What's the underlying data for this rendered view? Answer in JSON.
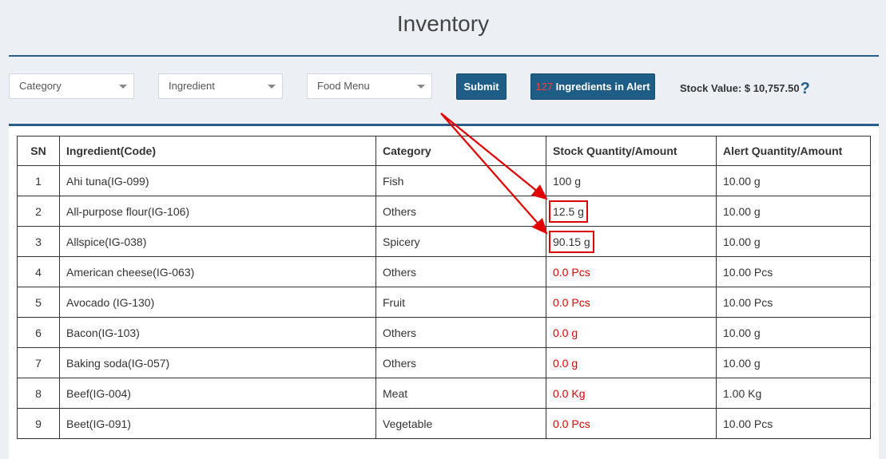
{
  "page": {
    "title": "Inventory"
  },
  "filters": {
    "category": "Category",
    "ingredient": "Ingredient",
    "food_menu": "Food Menu",
    "submit_label": "Submit"
  },
  "alert_button": {
    "count": "127",
    "label": " Ingredients in Alert"
  },
  "stock_value": {
    "label": "Stock Value: $ 10,757.50",
    "help_icon": "?"
  },
  "table": {
    "headers": [
      "SN",
      "Ingredient(Code)",
      "Category",
      "Stock Quantity/Amount",
      "Alert Quantity/Amount"
    ],
    "rows": [
      [
        "1",
        "Ahi tuna(IG-099)",
        "Fish",
        "100 g",
        "10.00 g"
      ],
      [
        "2",
        "All-purpose flour(IG-106)",
        "Others",
        "12.5 g",
        "10.00 g"
      ],
      [
        "3",
        "Allspice(IG-038)",
        "Spicery",
        "90.15 g",
        "10.00 g"
      ],
      [
        "4",
        "American cheese(IG-063)",
        "Others",
        "0.0 Pcs",
        "10.00 Pcs"
      ],
      [
        "5",
        "Avocado (IG-130)",
        "Fruit",
        "0.0 Pcs",
        "10.00 Pcs"
      ],
      [
        "6",
        "Bacon(IG-103)",
        "Others",
        "0.0 g",
        "10.00 g"
      ],
      [
        "7",
        "Baking soda(IG-057)",
        "Others",
        "0.0 g",
        "10.00 g"
      ],
      [
        "8",
        "Beef(IG-004)",
        "Meat",
        "0.0 Kg",
        "1.00 Kg"
      ],
      [
        "9",
        "Beet(IG-091)",
        "Vegetable",
        "0.0 Pcs",
        "10.00 Pcs"
      ]
    ]
  },
  "colors": {
    "brand": "#1e5d86",
    "alert_text": "#e00000",
    "annotation": "#e00000"
  },
  "annotations": {
    "highlighted_rows": [
      2,
      3
    ],
    "arrow_color": "#e00000"
  }
}
